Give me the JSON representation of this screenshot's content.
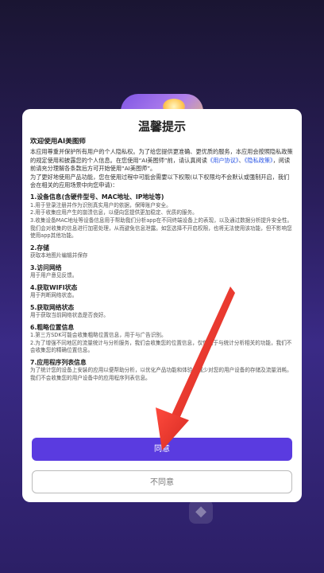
{
  "dialog": {
    "title": "温馨提示",
    "welcome": "欢迎使用AI美图师",
    "intro_part1": "本应用尊重并保护所有用户的个人隐私权。为了给您提供更准确、更优质的服务，本应用会按照隐私政策的规定使用和披露您的个人信息。在您使用“AI美图师”前，请认真阅读",
    "user_agreement_link": "《用户协议》",
    "separator": "、",
    "privacy_policy_link": "《隐私政策》",
    "intro_part2": "，阅读前请充分理解各条款后方可开始使用“AI美图师”。",
    "intro_permissions": "为了更好地使用产品功能，您在使用过程中可能会需要以下权限(以下权限均不会默认或强制开启，我们会在相关的应用场景中向您申请)：",
    "sections": [
      {
        "title": "1.设备信息(含硬件型号、MAC地址、IP地址等)",
        "lines": [
          "1.用于登录注册并作为识别真实用户的依据，保障账户安全。",
          "2.用于收集应用产生的崩溃信息，以便向您提供更加稳定、优质的服务。",
          "3.收集设备MAC地址等设备信息用于帮助我们分析app在不同终端设备上的表现，以及通过数据分析提升安全性。我们会对收集的信息进行加密处理，从而避免信息泄露。如您选择不开启权限，也将无法使用该功能，但不影响您使用app其他功能。"
        ]
      },
      {
        "title": "2.存储",
        "lines": [
          "获取本地图片编辑并保存"
        ]
      },
      {
        "title": "3.访问网络",
        "lines": [
          "用于用户意见反馈。"
        ]
      },
      {
        "title": "4.获取WIFI状态",
        "lines": [
          "用于判断网络状态。"
        ]
      },
      {
        "title": "5.获取网络状态",
        "lines": [
          "用于获取当前网络状态是否良好。"
        ]
      },
      {
        "title": "6.粗略位置信息",
        "lines": [
          "1.第三方SDK可能会收集粗略位置信息，用于与广告识别。",
          "2.为了增强不同地区的流量统计与分析服务，我们会收集您的位置信息，仅使用于与统计分析相关的功能，我们不会收集您的精确位置信息。"
        ]
      },
      {
        "title": "7.应用程序列表信息",
        "lines": [
          "为了统计您的设备上安装的应用以便帮助分析，以优化产品功能和体验，减少对您的用户设备的存储及流量消耗。我们不会收集您的用户设备中的应用程序列表信息。"
        ]
      }
    ],
    "agree_label": "同意",
    "disagree_label": "不同意"
  },
  "colors": {
    "accent": "#5a3be0",
    "link": "#2a55e5",
    "annotation_arrow": "#e8322c"
  },
  "icons": [
    "app-logo-icon",
    "red-arrow-annotation"
  ]
}
